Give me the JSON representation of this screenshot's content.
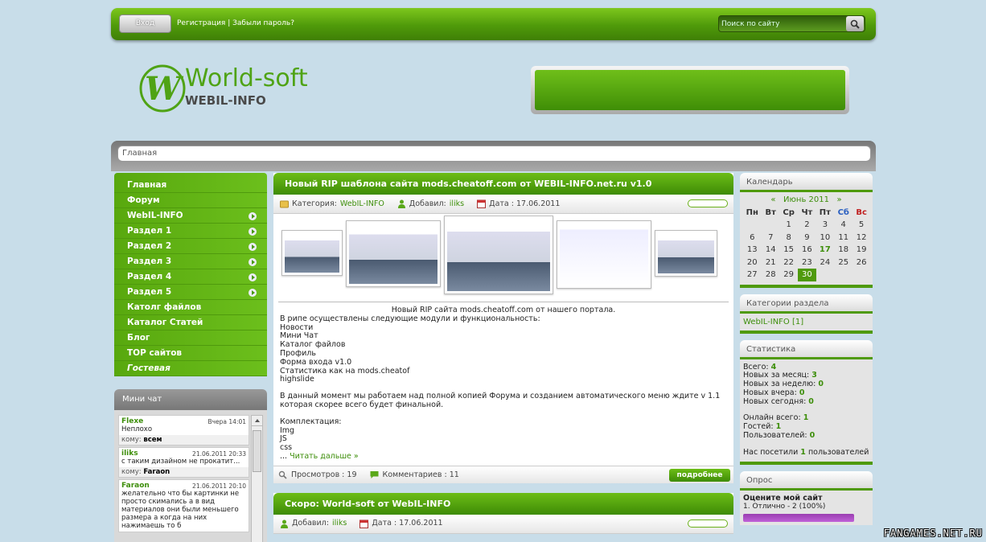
{
  "topbar": {
    "login_label": "Вход",
    "register_label": "Регистрация",
    "forgot_label": "Забыли пароль?",
    "search_placeholder": "Поиск по сайту"
  },
  "logo": {
    "title": "World-soft",
    "subtitle": "WEBIL-INFO"
  },
  "breadcrumb": "Главная",
  "menu": [
    {
      "label": "Главная",
      "arrow": false
    },
    {
      "label": "Форум",
      "arrow": false
    },
    {
      "label": "WebIL-INFO",
      "arrow": true
    },
    {
      "label": "Раздел 1",
      "arrow": true
    },
    {
      "label": "Раздел 2",
      "arrow": true
    },
    {
      "label": "Раздел 3",
      "arrow": true
    },
    {
      "label": "Раздел 4",
      "arrow": true
    },
    {
      "label": "Раздел 5",
      "arrow": true
    },
    {
      "label": "Католг файлов",
      "arrow": false
    },
    {
      "label": "Каталог Статей",
      "arrow": false
    },
    {
      "label": "Блог",
      "arrow": false
    },
    {
      "label": "TOP сайтов",
      "arrow": false
    },
    {
      "label": "Гостевая",
      "arrow": false
    }
  ],
  "minichat": {
    "title": "Мини чат",
    "to_label": "кому:",
    "messages": [
      {
        "name": "Flexe",
        "date": "Вчера 14:01",
        "text": "Неплохо",
        "to": "всем"
      },
      {
        "name": "iliks",
        "date": "21.06.2011 20:33",
        "text": "с таким дизайном не прокатит...",
        "to": "Faraon"
      },
      {
        "name": "Faraon",
        "date": "21.06.2011 20:10",
        "text": "желательно что бы картинки не просто скимались а в вид материалов они были меньшего размера а когда на них нажимаешь то б",
        "to": ""
      }
    ]
  },
  "posts": [
    {
      "title": "Новый RIP шаблона сайта mods.cheatoff.com от WEBIL-INFO.net.ru v1.0",
      "category_label": "Категория:",
      "category": "WebIL-INFO",
      "added_label": "Добавил:",
      "author": "iliks",
      "date_label": "Дата : 17.06.2011",
      "body_center": "Новый RIP сайта mods.cheatoff.com от нашего портала.",
      "body_lines": [
        "В рипе осуществлены следующие модули и функциональность:",
        "Новости",
        "Мини Чат",
        "Каталог файлов",
        "Профиль",
        "Форма входа v1.0",
        "Статистика как на mods.cheatof",
        "highslide"
      ],
      "body_para": "В данный момент мы работаем над полной копией Форума и созданием автоматического меню ждите v 1.1 которая скорее всего будет финальной.",
      "kit_lines": [
        "Комплектация:",
        "Img",
        "JS",
        "css"
      ],
      "read_more_prefix": "...",
      "read_more": "Читать дальше »",
      "views": "Просмотров : 19",
      "comments": "Комментариев : 11",
      "more_button": "подробнее"
    },
    {
      "title": "Скоро: World-soft от WebIL-INFO",
      "added_label": "Добавил:",
      "author": "iliks",
      "date_label": "Дата : 17.06.2011"
    }
  ],
  "calendar": {
    "title": "Календарь",
    "prev": "«",
    "month": "Июнь 2011",
    "next": "»",
    "weekdays": [
      "Пн",
      "Вт",
      "Ср",
      "Чт",
      "Пт",
      "Сб",
      "Вс"
    ],
    "rows": [
      [
        "",
        "",
        "1",
        "2",
        "3",
        "4",
        "5"
      ],
      [
        "6",
        "7",
        "8",
        "9",
        "10",
        "11",
        "12"
      ],
      [
        "13",
        "14",
        "15",
        "16",
        "17",
        "18",
        "19"
      ],
      [
        "20",
        "21",
        "22",
        "23",
        "24",
        "25",
        "26"
      ],
      [
        "27",
        "28",
        "29",
        "30",
        "",
        "",
        ""
      ]
    ],
    "bold_day": "17",
    "today": "30"
  },
  "categories": {
    "title": "Категории раздела",
    "item": "WebIL-INFO [1]"
  },
  "stats": {
    "title": "Статистика",
    "lines": [
      {
        "label": "Всего:",
        "value": "4"
      },
      {
        "label": "Новых за месяц:",
        "value": "3"
      },
      {
        "label": "Новых за неделю:",
        "value": "0"
      },
      {
        "label": "Новых вчера:",
        "value": "0"
      },
      {
        "label": "Новых сегодня:",
        "value": "0"
      }
    ],
    "online": [
      {
        "label": "Онлайн всего:",
        "value": "1"
      },
      {
        "label": "Гостей:",
        "value": "1"
      },
      {
        "label": "Пользователей:",
        "value": "0"
      }
    ],
    "visited_prefix": "Нас посетили",
    "visited_value": "1",
    "visited_suffix": "пользователей"
  },
  "poll": {
    "title": "Опрос",
    "question": "Оцените мой сайт",
    "option": "1. Отлично - 2 (100%)",
    "option_percent": 100
  },
  "watermark": "FANGAMES.NET.RU",
  "colors": {
    "accent": "#4f9a0d",
    "background": "#c8dde9",
    "link": "#3d8e0a"
  }
}
